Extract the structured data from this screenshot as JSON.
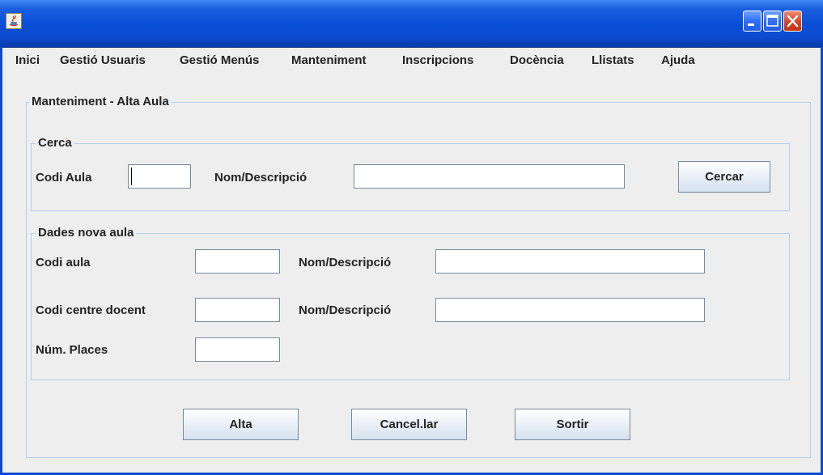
{
  "window": {
    "title": "",
    "app_icon": "java-app-icon",
    "controls": [
      "minimize-icon",
      "maximize-icon",
      "close-icon"
    ]
  },
  "menu": {
    "items": [
      "Inici",
      "Gestió Usuaris",
      "Gestió Menús",
      "Manteniment",
      "Inscripcions",
      "Docència",
      "Llistats",
      "Ajuda"
    ]
  },
  "form": {
    "title": "Manteniment - Alta Aula",
    "search": {
      "legend": "Cerca",
      "codi_label": "Codi Aula",
      "codi_value": "",
      "nom_label": "Nom/Descripció",
      "nom_value": "",
      "button_label": "Cercar"
    },
    "new": {
      "legend": "Dades nova aula",
      "codi_label": "Codi aula",
      "codi_value": "",
      "nom_label": "Nom/Descripció",
      "nom_value": "",
      "centre_label": "Codi centre docent",
      "centre_value": "",
      "centre_nom_label": "Nom/Descripció",
      "centre_nom_value": "",
      "places_label": "Núm. Places",
      "places_value": ""
    },
    "buttons": {
      "alta": "Alta",
      "cancel": "Cancel.lar",
      "exit": "Sortir"
    }
  },
  "colors": {
    "titlebar": "#0a4fd6",
    "panel_border": "#b8cfe5",
    "background": "#eeeeee",
    "close_button": "#d8442a"
  }
}
